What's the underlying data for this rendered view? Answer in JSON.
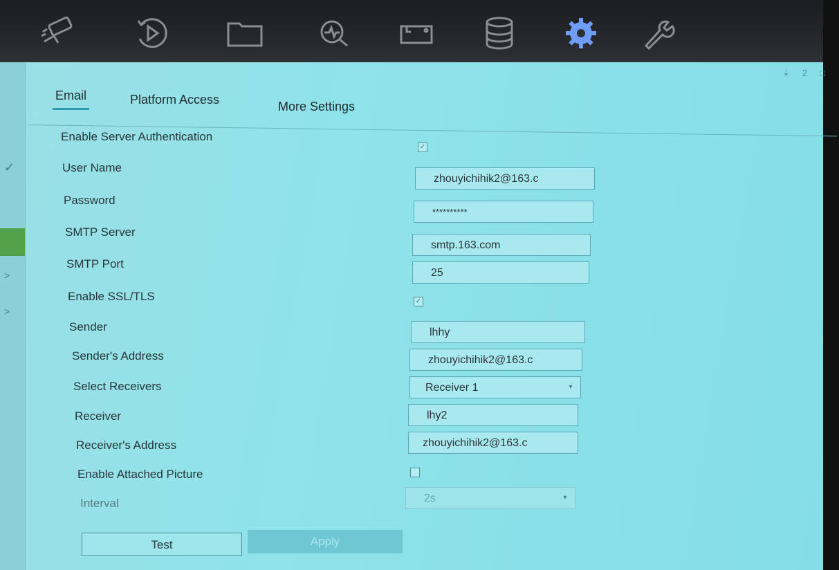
{
  "toolbar": {
    "icons": [
      "camera-icon",
      "playback-icon",
      "folder-icon",
      "smart-search-icon",
      "vca-icon",
      "storage-icon",
      "settings-gear-icon",
      "maintenance-wrench-icon"
    ],
    "active_icon": "settings-gear-icon",
    "tray_badge": "2"
  },
  "tabs": [
    {
      "label": "Email",
      "active": true
    },
    {
      "label": "Platform Access",
      "active": false
    },
    {
      "label": "More Settings",
      "active": false
    }
  ],
  "form": {
    "enable_server_auth": {
      "label": "Enable Server Authentication",
      "checked": true
    },
    "user_name": {
      "label": "User Name",
      "value": "zhouyichihik2@163.c"
    },
    "password": {
      "label": "Password",
      "value": "**********"
    },
    "smtp_server": {
      "label": "SMTP Server",
      "value": "smtp.163.com"
    },
    "smtp_port": {
      "label": "SMTP Port",
      "value": "25"
    },
    "enable_ssl": {
      "label": "Enable SSL/TLS",
      "checked": true
    },
    "sender": {
      "label": "Sender",
      "value": "lhhy"
    },
    "sender_address": {
      "label": "Sender's Address",
      "value": "zhouyichihik2@163.c"
    },
    "select_receivers": {
      "label": "Select Receivers",
      "value": "Receiver 1"
    },
    "receiver": {
      "label": "Receiver",
      "value": "lhy2"
    },
    "receiver_address": {
      "label": "Receiver's Address",
      "value": "zhouyichihik2@163.c"
    },
    "enable_attached_picture": {
      "label": "Enable Attached Picture",
      "checked": false
    },
    "interval": {
      "label": "Interval",
      "value": "2s"
    }
  },
  "buttons": {
    "test": "Test",
    "apply": "Apply"
  },
  "colors": {
    "accent": "#2d9db1",
    "active_icon": "#6f9df5",
    "screen_bg": "#8fe3ea",
    "status_green": "#52a24a"
  }
}
